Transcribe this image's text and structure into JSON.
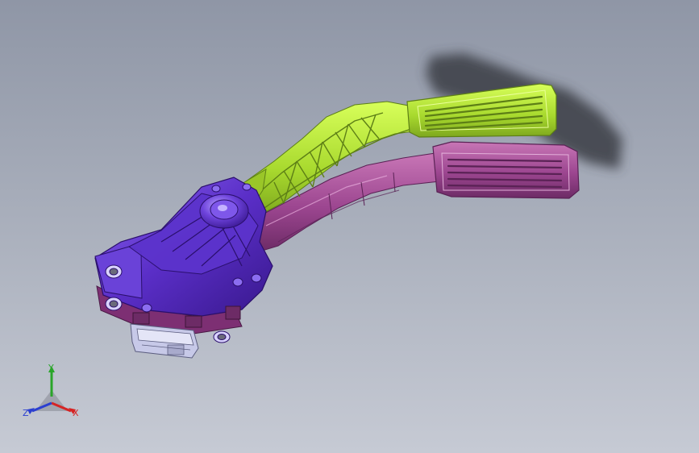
{
  "viewport": {
    "background_top": "#8f96a6",
    "background_bottom": "#c6cad4"
  },
  "model": {
    "parts": [
      {
        "name": "pedal-arm-upper",
        "color": "#b7e636"
      },
      {
        "name": "pedal-arm-lower",
        "color": "#a24d96"
      },
      {
        "name": "sensor-housing",
        "color": "#5b2fc4"
      },
      {
        "name": "connector",
        "color": "#c7c9e8"
      }
    ],
    "shadow_color": "#3a3d45"
  },
  "triad": {
    "x_label": "X",
    "y_label": "Y",
    "z_label": "Z",
    "x_color": "#d62424",
    "y_color": "#2aa52a",
    "z_color": "#2b3fd0"
  }
}
